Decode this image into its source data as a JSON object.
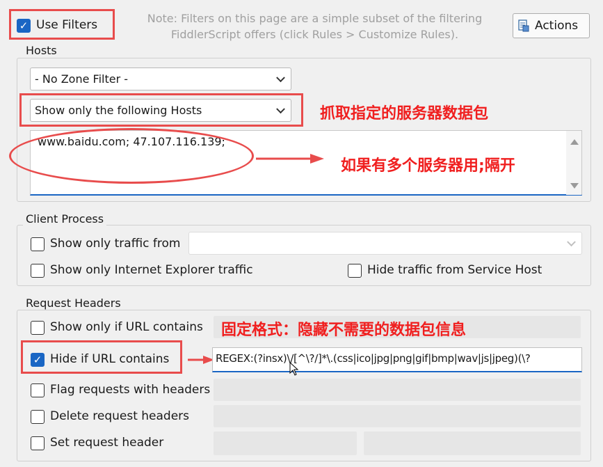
{
  "filters": {
    "use_filters_label": "Use Filters",
    "note_line1": "Note: Filters on this page are a simple subset of the filtering",
    "note_line2": "FiddlerScript offers (click Rules > Customize Rules).",
    "actions_label": "Actions"
  },
  "hosts": {
    "title": "Hosts",
    "zone_filter": "- No Zone Filter -",
    "host_filter": "Show only the following Hosts",
    "host_list": "www.baidu.com; 47.107.116.139;"
  },
  "client_process": {
    "title": "Client Process",
    "show_only_traffic_from": "Show only traffic from",
    "show_only_ie": "Show only Internet Explorer traffic",
    "hide_service_host": "Hide traffic from Service Host"
  },
  "request_headers": {
    "title": "Request Headers",
    "show_only_url": "Show only if URL contains",
    "hide_if_url": "Hide if URL contains",
    "hide_if_url_value": "REGEX:(?insx)\\/[^\\?/]*\\.(css|ico|jpg|png|gif|bmp|wav|js|jpeg)(\\?",
    "flag_requests": "Flag requests with headers",
    "delete_headers": "Delete request headers",
    "set_header": "Set request header"
  },
  "annotations": {
    "capture_hosts": "抓取指定的服务器数据包",
    "multiple_hosts": "如果有多个服务器用;隔开",
    "fixed_format": "固定格式：隐藏不需要的数据包信息",
    "color": "#f01f1f"
  }
}
